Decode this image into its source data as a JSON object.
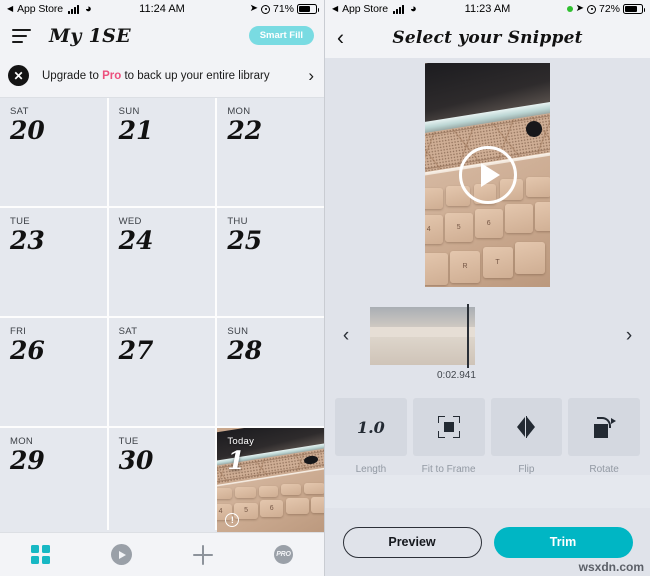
{
  "left": {
    "status": {
      "back_caret": "◀",
      "app_name": "App Store",
      "wifi_icon": "wifi-icon",
      "time": "11:24 AM",
      "location_icon": "➤",
      "alarm_icon": "alarm-icon",
      "battery_pct": "71%"
    },
    "nav": {
      "menu_icon": "hamburger-menu-icon",
      "title": "My 1SE",
      "smart_fill_label": "Smart Fill",
      "smart_fill_color": "#79dbe2"
    },
    "banner": {
      "close_icon": "✕",
      "text_before": "Upgrade to ",
      "highlight": "Pro",
      "text_after": " to back up your entire library",
      "highlight_color": "#ec4f7d",
      "chevron": "›"
    },
    "calendar": {
      "days": [
        {
          "dow": "SAT",
          "num": "20",
          "today": false
        },
        {
          "dow": "SUN",
          "num": "21",
          "today": false
        },
        {
          "dow": "MON",
          "num": "22",
          "today": false
        },
        {
          "dow": "TUE",
          "num": "23",
          "today": false
        },
        {
          "dow": "WED",
          "num": "24",
          "today": false
        },
        {
          "dow": "THU",
          "num": "25",
          "today": false
        },
        {
          "dow": "FRI",
          "num": "26",
          "today": false
        },
        {
          "dow": "SAT",
          "num": "27",
          "today": false
        },
        {
          "dow": "SUN",
          "num": "28",
          "today": false
        },
        {
          "dow": "MON",
          "num": "29",
          "today": false
        },
        {
          "dow": "TUE",
          "num": "30",
          "today": false
        },
        {
          "dow": "Today",
          "num": "1",
          "today": true,
          "badge": "!"
        }
      ]
    },
    "tabbar": {
      "items": [
        {
          "name": "grid-tab",
          "icon": "grid-icon",
          "active": true
        },
        {
          "name": "play-tab",
          "icon": "play-icon",
          "active": false
        },
        {
          "name": "add-tab",
          "icon": "plus-icon",
          "active": false
        },
        {
          "name": "pro-tab",
          "icon": "pro-icon",
          "label": "PRO",
          "active": false
        }
      ],
      "active_color": "#17b8c4"
    }
  },
  "right": {
    "status": {
      "back_caret": "◀",
      "app_name": "App Store",
      "wifi_icon": "wifi-icon",
      "time": "11:23 AM",
      "recording_dot": "recording-indicator",
      "recording_color": "#30c030",
      "location_icon": "➤",
      "alarm_icon": "alarm-icon",
      "battery_pct": "72%"
    },
    "nav": {
      "back_chevron": "‹",
      "title": "Select your Snippet"
    },
    "video": {
      "play_button": "play-button"
    },
    "scrubber": {
      "prev_arrow": "‹",
      "next_arrow": "›",
      "timestamp": "0:02.941"
    },
    "tools": [
      {
        "name": "length-tool",
        "icon": "length-value",
        "value": "1.0",
        "label": "Length"
      },
      {
        "name": "fit-to-frame-tool",
        "icon": "fit-to-frame-icon",
        "label": "Fit to Frame"
      },
      {
        "name": "flip-tool",
        "icon": "flip-icon",
        "label": "Flip"
      },
      {
        "name": "rotate-tool",
        "icon": "rotate-icon",
        "label": "Rotate"
      }
    ],
    "actions": {
      "preview_label": "Preview",
      "trim_label": "Trim",
      "trim_color": "#00b6c4"
    },
    "watermark": "wsxdn.com"
  }
}
